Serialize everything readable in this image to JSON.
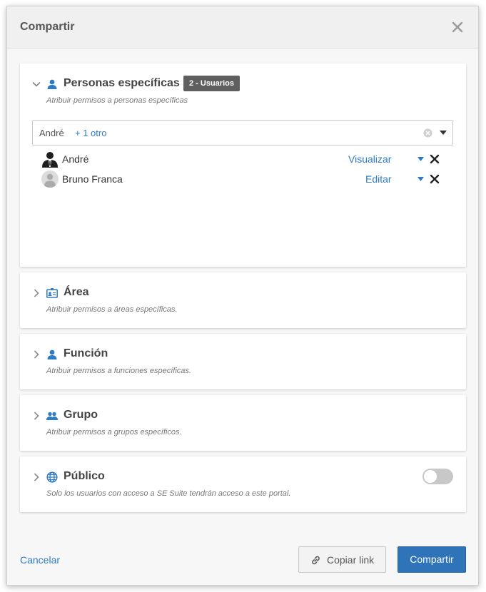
{
  "dialog": {
    "title": "Compartir"
  },
  "sections": [
    {
      "title": "Personas específicas",
      "subtitle": "Atribuir permisos a personas específicas",
      "badge": "2 - Usuarios",
      "expanded": true,
      "icon": "person-icon"
    },
    {
      "title": "Área",
      "subtitle": "Atribuir permisos a áreas específicas.",
      "icon": "id-card-icon"
    },
    {
      "title": "Función",
      "subtitle": "Atribuir permisos a funciones específicas.",
      "icon": "person-icon"
    },
    {
      "title": "Grupo",
      "subtitle": "Atribuir permisos a grupos específicos.",
      "icon": "group-icon"
    },
    {
      "title": "Público",
      "subtitle": "Solo los usuarios con acceso a SE Suite tendrán acceso a este portal.",
      "icon": "globe-icon",
      "toggle_on": false
    }
  ],
  "selector": {
    "value": "André",
    "more": "+ 1 otro"
  },
  "users": [
    {
      "name": "André",
      "permission": "Visualizar"
    },
    {
      "name": "Bruno Franca",
      "permission": "Editar"
    }
  ],
  "footer": {
    "cancel": "Cancelar",
    "copy_link": "Copiar link",
    "share": "Compartir"
  },
  "colors": {
    "accent": "#2f7bc4",
    "primary_button": "#2f73b9",
    "badge": "#5f5f5f",
    "toggle_off": "#c8c8c8"
  }
}
